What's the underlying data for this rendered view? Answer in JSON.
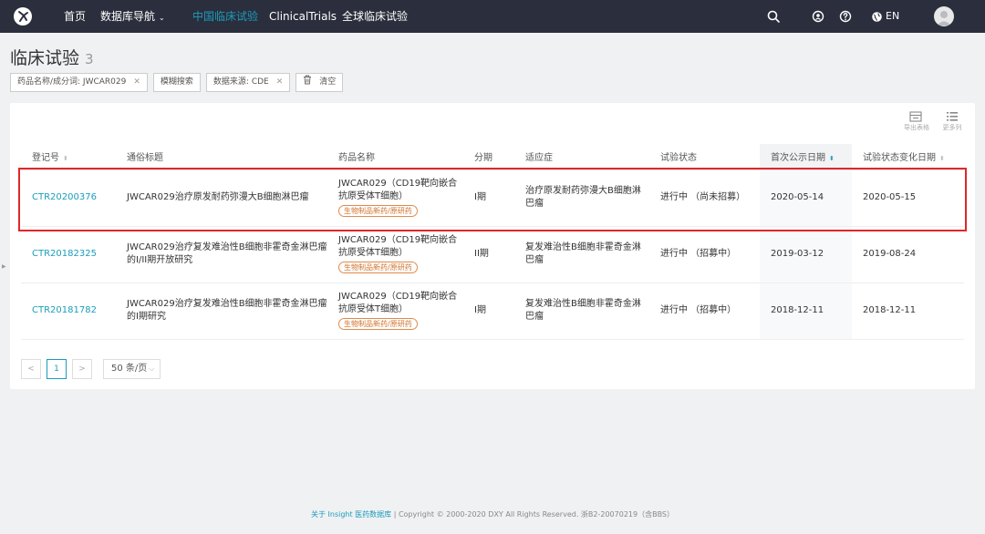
{
  "nav": {
    "items": [
      {
        "label": "首页",
        "active": false
      },
      {
        "label": "数据库导航",
        "active": false,
        "caret": "⌄"
      },
      {
        "label": "中国临床试验",
        "active": true
      },
      {
        "label": "ClinicalTrials",
        "active": false
      },
      {
        "label": "全球临床试验",
        "active": false
      }
    ],
    "lang": "EN"
  },
  "page": {
    "title": "临床试验",
    "count": "3"
  },
  "filters": {
    "drug_chip": "药品名称/成分词: JWCAR029",
    "fuzzy_chip": "模糊搜索",
    "source_chip": "数据来源: CDE",
    "clear_label": "清空"
  },
  "toolbar": {
    "export_label": "导出表格",
    "more_label": "更多列"
  },
  "table": {
    "columns": [
      "登记号",
      "通俗标题",
      "药品名称",
      "分期",
      "适应症",
      "试验状态",
      "首次公示日期",
      "试验状态变化日期"
    ],
    "rows": [
      {
        "reg": "CTR20200376",
        "title": "JWCAR029治疗原发耐药弥漫大B细胞淋巴瘤",
        "drug": "JWCAR029（CD19靶向嵌合抗原受体T细胞）",
        "drug_tag": "生物制品新药/原研药",
        "phase": "I期",
        "indication": "治疗原发耐药弥漫大B细胞淋巴瘤",
        "status": "进行中 （尚未招募）",
        "first_date": "2020-05-14",
        "change_date": "2020-05-15"
      },
      {
        "reg": "CTR20182325",
        "title": "JWCAR029治疗复发难治性B细胞非霍奇金淋巴瘤的I/II期开放研究",
        "drug": "JWCAR029（CD19靶向嵌合抗原受体T细胞）",
        "drug_tag": "生物制品新药/原研药",
        "phase": "II期",
        "indication": "复发难治性B细胞非霍奇金淋巴瘤",
        "status": "进行中 （招募中）",
        "first_date": "2019-03-12",
        "change_date": "2019-08-24"
      },
      {
        "reg": "CTR20181782",
        "title": "JWCAR029治疗复发难治性B细胞非霍奇金淋巴瘤的I期研究",
        "drug": "JWCAR029（CD19靶向嵌合抗原受体T细胞）",
        "drug_tag": "生物制品新药/原研药",
        "phase": "I期",
        "indication": "复发难治性B细胞非霍奇金淋巴瘤",
        "status": "进行中 （招募中）",
        "first_date": "2018-12-11",
        "change_date": "2018-12-11"
      }
    ]
  },
  "pager": {
    "prev": "<",
    "current": "1",
    "next": ">",
    "page_size": "50 条/页"
  },
  "footer": {
    "link": "关于 Insight 医药数据库",
    "text": " | Copyright © 2000-2020 DXY All Rights Reserved. 浙B2-20070219（含BBS）"
  },
  "colors": {
    "nav_bg": "#2b2e3c",
    "accent": "#1a9dbb",
    "tag": "#d1722b",
    "highlight": "#e0262a"
  }
}
